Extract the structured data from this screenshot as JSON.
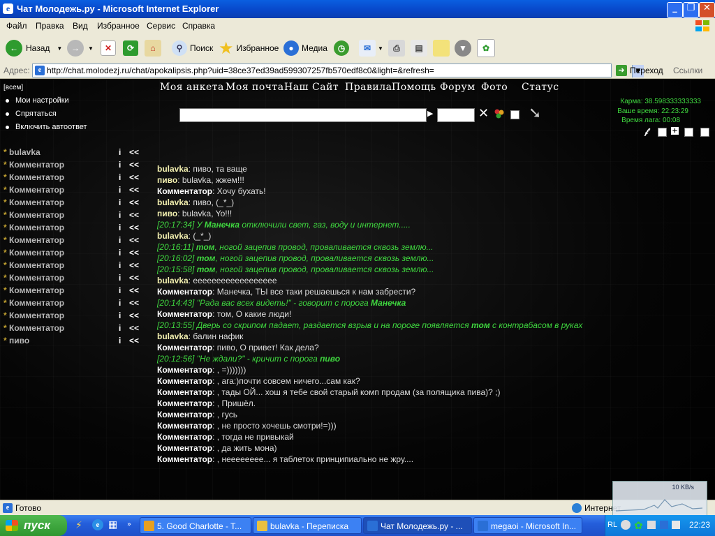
{
  "window": {
    "title": "Чат Молодежь.ру - Microsoft Internet Explorer"
  },
  "menu": [
    "Файл",
    "Правка",
    "Вид",
    "Избранное",
    "Сервис",
    "Справка"
  ],
  "toolbar": {
    "back": "Назад",
    "search": "Поиск",
    "favorites": "Избранное",
    "media": "Медиа"
  },
  "address": {
    "label": "Адрес:",
    "url": "http://chat.molodezj.ru/chat/apokalipsis.php?uid=38ce37ed39ad599307257fb570edf8c0&light=&refresh=",
    "go": "Переход",
    "links": "Ссылки"
  },
  "chat_page": {
    "all_button": "[всем]",
    "options": [
      "Мои настройки",
      "Спрятаться",
      "Включить автоответ"
    ],
    "nav": [
      "Моя анкета",
      "Моя почта",
      "Наш Сайт",
      "Правила",
      "Помощь",
      "Форум",
      "Фото",
      "Статус"
    ],
    "info": {
      "karma": "Карма: 38.598333333333",
      "time": "Ваше время: 22:23:29",
      "lag": "Время лага:  00:08"
    },
    "users": [
      {
        "star": "*",
        "name": "bulavka",
        "i": "i",
        "r": "<<"
      },
      {
        "star": "*",
        "name": "Комментатор",
        "i": "i",
        "r": "<<"
      },
      {
        "star": "*",
        "name": "Комментатор",
        "i": "i",
        "r": "<<"
      },
      {
        "star": "*",
        "name": "Комментатор",
        "i": "i",
        "r": "<<"
      },
      {
        "star": "*",
        "name": "Комментатор",
        "i": "i",
        "r": "<<"
      },
      {
        "star": "*",
        "name": "Комментатор",
        "i": "i",
        "r": "<<"
      },
      {
        "star": "*",
        "name": "Комментатор",
        "i": "i",
        "r": "<<"
      },
      {
        "star": "*",
        "name": "Комментатор",
        "i": "i",
        "r": "<<"
      },
      {
        "star": "*",
        "name": "Комментатор",
        "i": "i",
        "r": "<<"
      },
      {
        "star": "*",
        "name": "Комментатор",
        "i": "i",
        "r": "<<"
      },
      {
        "star": "*",
        "name": "Комментатор",
        "i": "i",
        "r": "<<"
      },
      {
        "star": "*",
        "name": "Комментатор",
        "i": "i",
        "r": "<<"
      },
      {
        "star": "*",
        "name": "Комментатор",
        "i": "i",
        "r": "<<"
      },
      {
        "star": "*",
        "name": "Комментатор",
        "i": "i",
        "r": "<<"
      },
      {
        "star": "*",
        "name": "Комментатор",
        "i": "i",
        "r": "<<"
      },
      {
        "star": "*",
        "name": "пиво",
        "i": "i",
        "r": "<<"
      }
    ],
    "messages": [
      {
        "author": "bulavka",
        "text": ": пиво, та ваще"
      },
      {
        "author": "пиво",
        "text": ": bulavka, жжем!!!"
      },
      {
        "author": "Комментатор",
        "text": ": Хочу бухать!"
      },
      {
        "author": "bulavka",
        "text": ": пиво, (_*_)"
      },
      {
        "author": "пиво",
        "text": ": bulavka, Yo!!!"
      },
      {
        "sys1": "[20:17:34] У ",
        "sysname": "Манечка",
        "sys2": " отключили свет, газ, воду и интернет....."
      },
      {
        "author": "bulavka",
        "text": ": (_*_)"
      },
      {
        "sys1": "[20:16:11] ",
        "sysname": "том",
        "sys2": ", ногой зацепив провод, проваливается сквозь землю..."
      },
      {
        "sys1": "[20:16:02] ",
        "sysname": "том",
        "sys2": ", ногой зацепив провод, проваливается сквозь землю..."
      },
      {
        "sys1": "[20:15:58] ",
        "sysname": "том",
        "sys2": ", ногой зацепив провод, проваливается сквозь землю..."
      },
      {
        "author": "bulavka",
        "text": ": ееееееееееееееееее"
      },
      {
        "author": "Комментатор",
        "text": ": Манечка, ТЫ все таки решаешься к нам забрести?"
      },
      {
        "sys1": "[20:14:43] \"Рада вас всех видеть!\" - говорит с порога ",
        "sysname": "Манечка",
        "sys2": ""
      },
      {
        "author": "Комментатор",
        "text": ": том, О какие люди!"
      },
      {
        "sys1": "[20:13:55] Дверь со скрипом падает, раздается взрыв и на пороге появляется ",
        "sysname": "том",
        "sys2": " с контрабасом в руках"
      },
      {
        "author": "bulavka",
        "text": ": балин нафик"
      },
      {
        "author": "Комментатор",
        "text": ": пиво, О привет! Как дела?"
      },
      {
        "sys1": "[20:12:56] \"Не ждали?\" - кричит с порога ",
        "sysname": "пиво",
        "sys2": ""
      },
      {
        "author": "Комментатор",
        "text": ": , =)))))))"
      },
      {
        "author": "Комментатор",
        "text": ": , ага:)почти совсем ничего...сам как?"
      },
      {
        "author": "Комментатор",
        "text": ": , тады ОЙ... хош я тебе свой старый комп продам (за полящика пива)? ;)"
      },
      {
        "author": "Комментатор",
        "text": ": , Пришёл."
      },
      {
        "author": "Комментатор",
        "text": ": , гусь"
      },
      {
        "author": "Комментатор",
        "text": ": , не просто хочешь смотри!=)))"
      },
      {
        "author": "Комментатор",
        "text": ": , тогда не привыкай"
      },
      {
        "author": "Комментатор",
        "text": ": , да жить мона)"
      },
      {
        "author": "Комментатор",
        "text": ": , нееееееее... я таблеток принципиально не жру...."
      }
    ]
  },
  "status": {
    "text": "Готово",
    "zone": "Интернет",
    "netspeed": "10 KB/s"
  },
  "taskbar": {
    "start": "пуск",
    "tasks": [
      {
        "label": "5. Good Charlotte - T...",
        "color": "#e8a020"
      },
      {
        "label": "bulavka - Переписка",
        "color": "#e9c040"
      },
      {
        "label": "Чат Молодежь.ру - ...",
        "color": "#2a6fd6"
      },
      {
        "label": "megaoi - Microsoft In...",
        "color": "#2a6fd6"
      }
    ],
    "lang": "RL",
    "clock": "22:23"
  }
}
